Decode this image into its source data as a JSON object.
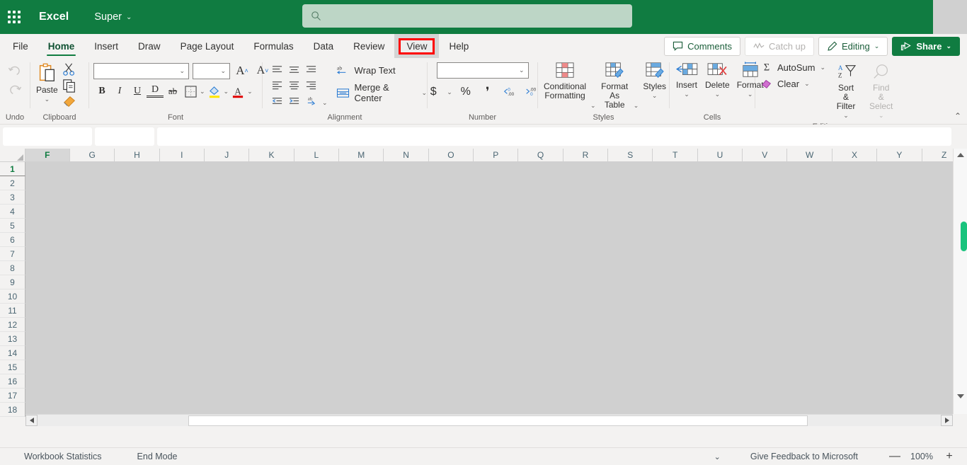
{
  "topbar": {
    "waffle_label": "app-launcher",
    "app_name": "Excel",
    "document_name": "Super",
    "document_chevron": "⌄",
    "search_placeholder": "",
    "search_value": ""
  },
  "tabs": [
    {
      "label": "File",
      "active": false
    },
    {
      "label": "Home",
      "active": true
    },
    {
      "label": "Insert",
      "active": false
    },
    {
      "label": "Draw",
      "active": false
    },
    {
      "label": "Page Layout",
      "active": false
    },
    {
      "label": "Formulas",
      "active": false
    },
    {
      "label": "Data",
      "active": false
    },
    {
      "label": "Review",
      "active": false
    },
    {
      "label": "View",
      "active": false,
      "highlighted": true
    },
    {
      "label": "Help",
      "active": false
    }
  ],
  "tab_actions": {
    "comments": "Comments",
    "catch_up": "Catch up",
    "editing": "Editing",
    "share": "Share",
    "chevron": "⌄"
  },
  "ribbon": {
    "undo": {
      "group_label": "Undo",
      "undo_name": "undo-arrow",
      "redo_name": "redo-arrow"
    },
    "clipboard": {
      "group_label": "Clipboard",
      "paste": "Paste",
      "paste_chevron": "⌄",
      "cut_name": "scissors-icon",
      "copy_name": "copy-icon",
      "format_painter_name": "format-painter-icon"
    },
    "font": {
      "group_label": "Font",
      "font_name_value": "",
      "font_size_value": "",
      "chevron": "⌄",
      "grow_font": "A",
      "shrink_font": "A",
      "bold": "B",
      "italic": "I",
      "underline": "U",
      "double_underline": "D",
      "strikethrough": "ab",
      "borders_name": "borders-icon",
      "fill_color_name": "fill-color-icon",
      "font_color_name": "font-color-icon",
      "fill_color": "#ffe600",
      "font_color": "#e00000"
    },
    "alignment": {
      "group_label": "Alignment",
      "wrap_text": "Wrap Text",
      "merge_center": "Merge & Center",
      "merge_chevron": "⌄",
      "orientation_chevron": "⌄"
    },
    "number": {
      "group_label": "Number",
      "format_value": "",
      "chevron": "⌄",
      "currency": "$",
      "percent": "%",
      "comma": "❜",
      "increase_decimal_name": "increase-decimal-icon",
      "decrease_decimal_name": "decrease-decimal-icon"
    },
    "styles": {
      "group_label": "Styles",
      "conditional_formatting": "Conditional Formatting",
      "format_as_table": "Format As Table",
      "styles": "Styles",
      "chevron": "⌄"
    },
    "cells": {
      "group_label": "Cells",
      "insert": "Insert",
      "delete": "Delete",
      "format": "Format",
      "chevron": "⌄"
    },
    "editing": {
      "group_label": "Editing",
      "autosum": "AutoSum",
      "clear": "Clear",
      "sort_filter": "Sort & Filter",
      "find_select": "Find & Select",
      "chevron": "⌄"
    },
    "collapse_chevron": "⌃"
  },
  "formula_bar": {
    "name_box_value": "",
    "fx_value": "",
    "formula_value": ""
  },
  "grid": {
    "columns": [
      "F",
      "G",
      "H",
      "I",
      "J",
      "K",
      "L",
      "M",
      "N",
      "O",
      "P",
      "Q",
      "R",
      "S",
      "T",
      "U",
      "V",
      "W",
      "X",
      "Y",
      "Z"
    ],
    "selected_column": "F",
    "rows": [
      "1",
      "2",
      "3",
      "4",
      "5",
      "6",
      "7",
      "8",
      "9",
      "10",
      "11",
      "12",
      "13",
      "14",
      "15",
      "16",
      "17",
      "18"
    ],
    "selected_row": "1"
  },
  "statusbar": {
    "workbook_statistics": "Workbook Statistics",
    "end_mode": "End Mode",
    "chevron": "⌄",
    "feedback": "Give Feedback to Microsoft",
    "zoom_out": "—",
    "zoom_level": "100%",
    "zoom_in": "+"
  },
  "colors": {
    "excel_green": "#107c41",
    "search_bg": "#bdd6c6",
    "ribbon_bg": "#f3f2f1",
    "highlight_red": "#ff0000",
    "grid_bg": "#d0d0d0",
    "scroll_thumb_green": "#19c37d"
  }
}
